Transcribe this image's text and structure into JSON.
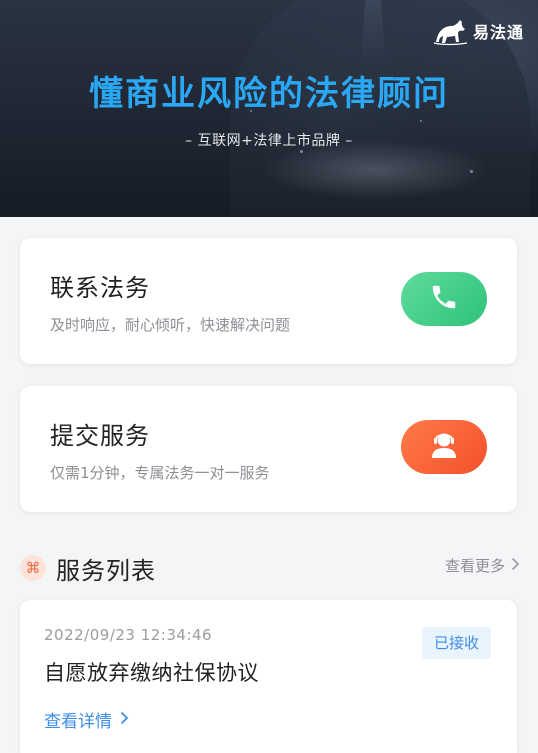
{
  "banner": {
    "brand_name": "易法通",
    "title": "懂商业风险的法律顾问",
    "subtitle": "– 互联网+法律上市品牌 –"
  },
  "contact_card": {
    "title": "联系法务",
    "description": "及时响应，耐心倾听，快速解决问题",
    "icon": "phone-icon",
    "accent": "#3cc986"
  },
  "submit_card": {
    "title": "提交服务",
    "description": "仅需1分钟，专属法务一对一服务",
    "icon": "customer-service-icon",
    "accent": "#f65a33"
  },
  "service_list": {
    "title": "服务列表",
    "more_label": "查看更多",
    "icon": "grid-icon",
    "items": [
      {
        "time": "2022/09/23  12:34:46",
        "status": "已接收",
        "name": "自愿放弃缴纳社保协议",
        "link_label": "查看详情"
      }
    ]
  },
  "colors": {
    "title_blue": "#2aa8f5",
    "link_blue": "#3e8ee8",
    "badge_bg": "#e9f4fe"
  }
}
